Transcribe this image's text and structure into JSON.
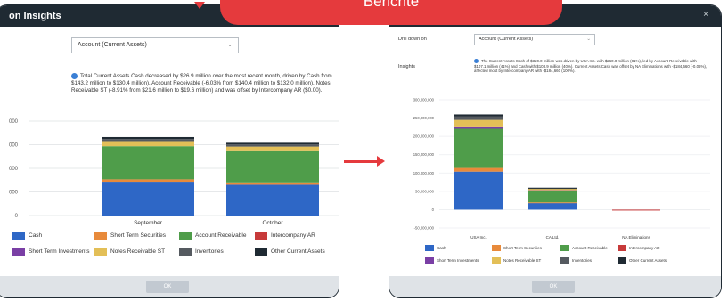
{
  "banner": {
    "label": "Berichte"
  },
  "left_panel": {
    "title": "on Insights",
    "dropdown_value": "Account (Current Assets)",
    "insight_text": "Total Current Assets Cash decreased by $26.9 million over the most recent month, driven by Cash from $143.2 million to $130.4 million), Account Receivable (-6.03% from $140.4 million to $132.0 million), Notes Receivable ST (-8.91% from $21.6 million to $19.6 million) and was offset by Intercompany AR ($0.00).",
    "ok_label": "OK",
    "y_ticks": [
      "000",
      "000",
      "000",
      "000",
      "0"
    ],
    "legend": [
      {
        "label": "Cash",
        "color": "#2e67c6"
      },
      {
        "label": "Short Term Securities",
        "color": "#e88a3b"
      },
      {
        "label": "Account Receivable",
        "color": "#4f9d4a"
      },
      {
        "label": "Intercompany AR",
        "color": "#c73a3a"
      },
      {
        "label": "Short Term Investments",
        "color": "#7a3fa5"
      },
      {
        "label": "Notes Receivable ST",
        "color": "#e3bf57"
      },
      {
        "label": "Inventories",
        "color": "#555a60"
      },
      {
        "label": "Other Current Assets",
        "color": "#1f2a33"
      }
    ]
  },
  "right_panel": {
    "drill_label": "Drill down on",
    "dropdown_value": "Account (Current Assets)",
    "insights_label": "Insights",
    "insight_text": "The Current Assets Cash of $320.0 million was driven by USA Inc. with $260.0 million (81%), led by Account Receivable with $107.1 million (41%) and Cash with $103.9 million (40%). Current Assets Cash was offset by NA Eliminations with -$184,660 (-0.06%), affected most by Intercompany AR with -$184,660 (100%).",
    "y_ticks": [
      "300,000,000",
      "250,000,000",
      "200,000,000",
      "150,000,000",
      "100,000,000",
      "50,000,000",
      "0",
      "-50,000,000"
    ],
    "ok_label": "OK",
    "close_glyph": "×",
    "legend": [
      {
        "label": "Cash",
        "color": "#2e67c6"
      },
      {
        "label": "Short Term Securities",
        "color": "#e88a3b"
      },
      {
        "label": "Account Receivable",
        "color": "#4f9d4a"
      },
      {
        "label": "Intercompany AR",
        "color": "#c73a3a"
      },
      {
        "label": "Short Term Investments",
        "color": "#7a3fa5"
      },
      {
        "label": "Notes Receivable ST",
        "color": "#e3bf57"
      },
      {
        "label": "Inventories",
        "color": "#555a60"
      },
      {
        "label": "Other Current Assets",
        "color": "#1f2a33"
      }
    ]
  },
  "chart_data": [
    {
      "type": "bar",
      "stacked": true,
      "categories": [
        "September",
        "October"
      ],
      "series": [
        {
          "name": "Cash",
          "values": [
            143.2,
            130.4
          ]
        },
        {
          "name": "Short Term Securities",
          "values": [
            10.0,
            10.0
          ]
        },
        {
          "name": "Account Receivable",
          "values": [
            140.4,
            132.0
          ]
        },
        {
          "name": "Notes Receivable ST",
          "values": [
            21.6,
            19.6
          ]
        },
        {
          "name": "Inventories",
          "values": [
            9.0,
            9.0
          ]
        },
        {
          "name": "Other Current Assets",
          "values": [
            8.0,
            7.0
          ]
        }
      ],
      "ylim": [
        0,
        400
      ]
    },
    {
      "type": "bar",
      "stacked": true,
      "categories": [
        "USA Inc.",
        "CA Ltd.",
        "NA Eliminations"
      ],
      "series": [
        {
          "name": "Cash",
          "values": [
            103900000,
            18000000,
            0
          ]
        },
        {
          "name": "Short Term Securities",
          "values": [
            10000000,
            2000000,
            0
          ]
        },
        {
          "name": "Account Receivable",
          "values": [
            107100000,
            32000000,
            0
          ]
        },
        {
          "name": "Intercompany AR",
          "values": [
            0,
            0,
            -184660
          ]
        },
        {
          "name": "Short Term Investments",
          "values": [
            4000000,
            1000000,
            0
          ]
        },
        {
          "name": "Notes Receivable ST",
          "values": [
            20000000,
            4000000,
            0
          ]
        },
        {
          "name": "Inventories",
          "values": [
            10000000,
            2000000,
            0
          ]
        },
        {
          "name": "Other Current Assets",
          "values": [
            5000000,
            1000000,
            0
          ]
        }
      ],
      "ylim": [
        -50000000,
        300000000
      ]
    }
  ]
}
